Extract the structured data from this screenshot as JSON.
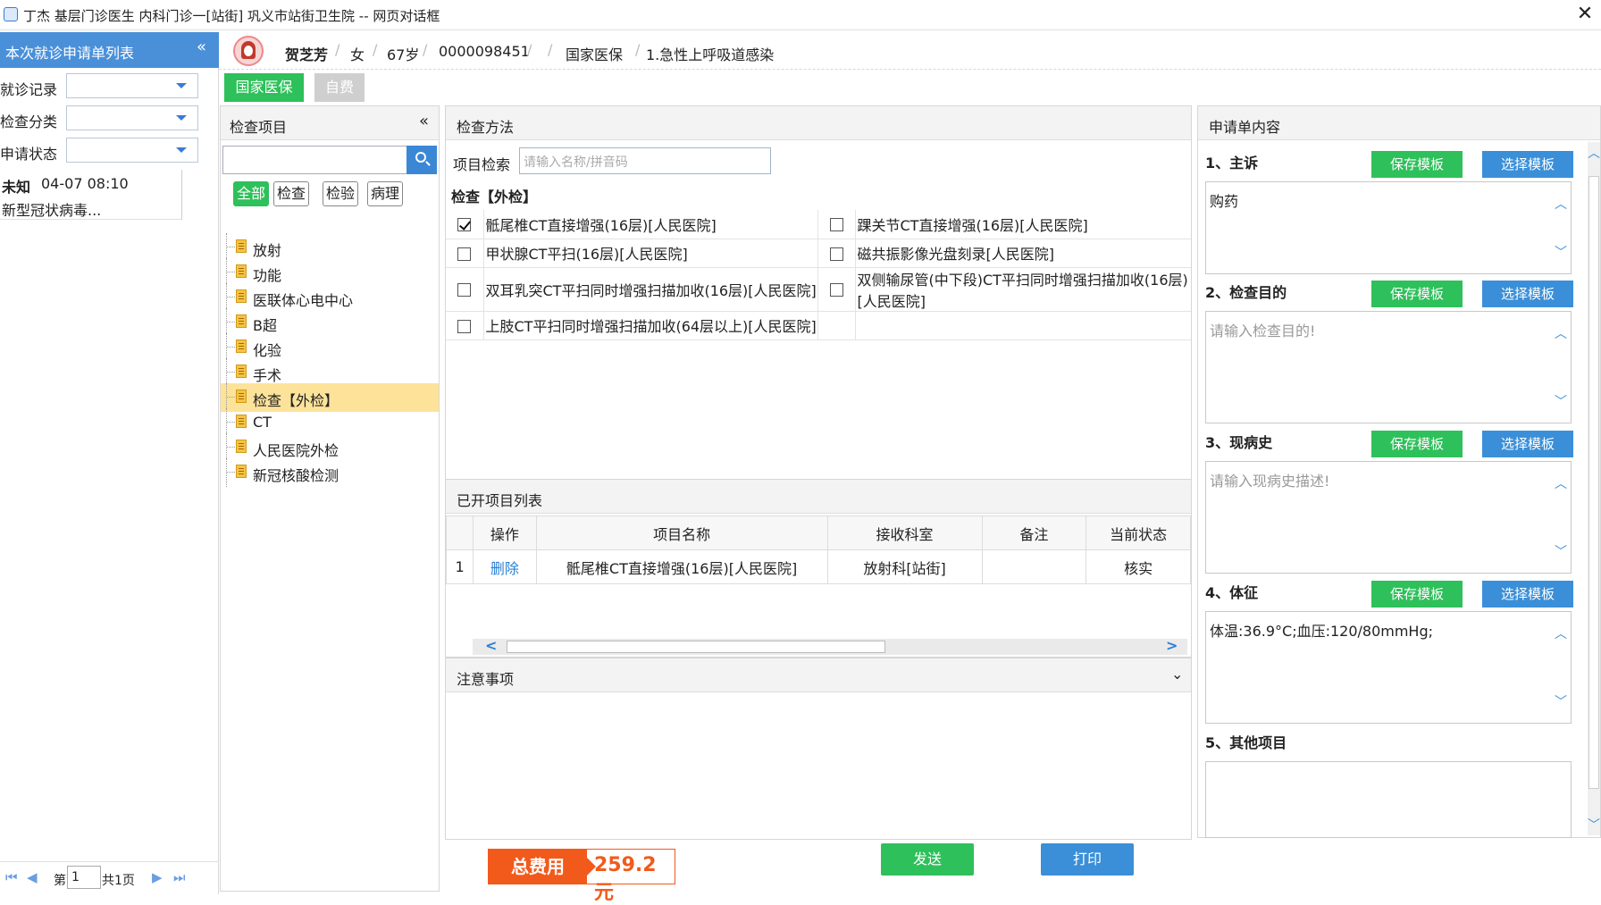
{
  "window": {
    "title": "丁杰 基层门诊医生 内科门诊一[站街] 巩义市站街卫生院 -- 网页对话框",
    "close": "✕"
  },
  "left": {
    "header": "本次就诊申请单列表",
    "collapse": "«",
    "filters": [
      {
        "label": "就诊记录",
        "value": ""
      },
      {
        "label": "检查分类",
        "value": ""
      },
      {
        "label": "申请状态",
        "value": ""
      }
    ],
    "record": {
      "name": "未知",
      "time": "04-07 08:10",
      "diagnosis": "新型冠状病毒..."
    },
    "pager": {
      "first": "⏮",
      "prev": "◀",
      "page_prefix": "第",
      "page": "1",
      "total": "共1页",
      "next": "▶",
      "last": "⏭"
    }
  },
  "patient": {
    "name": "贺芝芳",
    "gender": "女",
    "age": "67岁",
    "id": "0000098451",
    "insurance": "国家医保",
    "diagnosis": "1.急性上呼吸道感染",
    "sep": "/"
  },
  "payment": {
    "national": "国家医保",
    "self": "自费"
  },
  "items": {
    "header": "检查项目",
    "collapse": "«",
    "search_value": "",
    "tabs": [
      "全部",
      "检查",
      "检验",
      "病理"
    ],
    "tree": [
      "放射",
      "功能",
      "医联体心电中心",
      "B超",
      "化验",
      "手术",
      "检查【外检】",
      "CT",
      "人民医院外检",
      "新冠核酸检测"
    ],
    "selected": "检查【外检】"
  },
  "method": {
    "header": "检查方法",
    "search_label": "项目检索",
    "search_placeholder": "请输入名称/拼音码",
    "section": "检查【外检】",
    "rows": [
      [
        {
          "name": "骶尾椎CT直接增强(16层)[人民医院]",
          "checked": true
        },
        {
          "name": "踝关节CT直接增强(16层)[人民医院]",
          "checked": false
        }
      ],
      [
        {
          "name": "甲状腺CT平扫(16层)[人民医院]",
          "checked": false
        },
        {
          "name": "磁共振影像光盘刻录[人民医院]",
          "checked": false
        }
      ],
      [
        {
          "name": "双耳乳突CT平扫同时增强扫描加收(16层)[人民医院]",
          "checked": false
        },
        {
          "name": "双侧输尿管(中下段)CT平扫同时增强扫描加收(16层)[人民医院]",
          "checked": false
        }
      ],
      [
        {
          "name": "上肢CT平扫同时增强扫描加收(64层以上)[人民医院]",
          "checked": false
        },
        null
      ]
    ]
  },
  "opened": {
    "header": "已开项目列表",
    "columns": [
      "",
      "操作",
      "项目名称",
      "接收科室",
      "备注",
      "当前状态"
    ],
    "rows": [
      {
        "index": "1",
        "action": "删除",
        "name": "骶尾椎CT直接增强(16层)[人民医院]",
        "dept": "放射科[站街]",
        "note": "",
        "status": "核实"
      }
    ],
    "scroll_left": "<",
    "scroll_right": ">"
  },
  "notes": {
    "header": "注意事项",
    "expand": "⌄"
  },
  "footer": {
    "total_label": "总费用",
    "total_value": "259.2元",
    "send": "发送",
    "print": "打印"
  },
  "request": {
    "header": "申请单内容",
    "save": "保存模板",
    "choose": "选择模板",
    "sections": [
      {
        "label": "1、主诉",
        "value": "购药",
        "placeholder": ""
      },
      {
        "label": "2、检查目的",
        "value": "",
        "placeholder": "请输入检查目的!"
      },
      {
        "label": "3、现病史",
        "value": "",
        "placeholder": "请输入现病史描述!"
      },
      {
        "label": "4、体征",
        "value": "体温:36.9°C;血压:120/80mmHg;",
        "placeholder": ""
      },
      {
        "label": "5、其他项目",
        "value": "",
        "placeholder": ""
      }
    ],
    "arrow_up": "︿",
    "arrow_down": "﹀"
  },
  "colors": {
    "header_blue": "#4a90d9",
    "green": "#2ec05a",
    "blue": "#3a8fd8",
    "orange": "#f25a1b",
    "selected": "#fde39a"
  }
}
